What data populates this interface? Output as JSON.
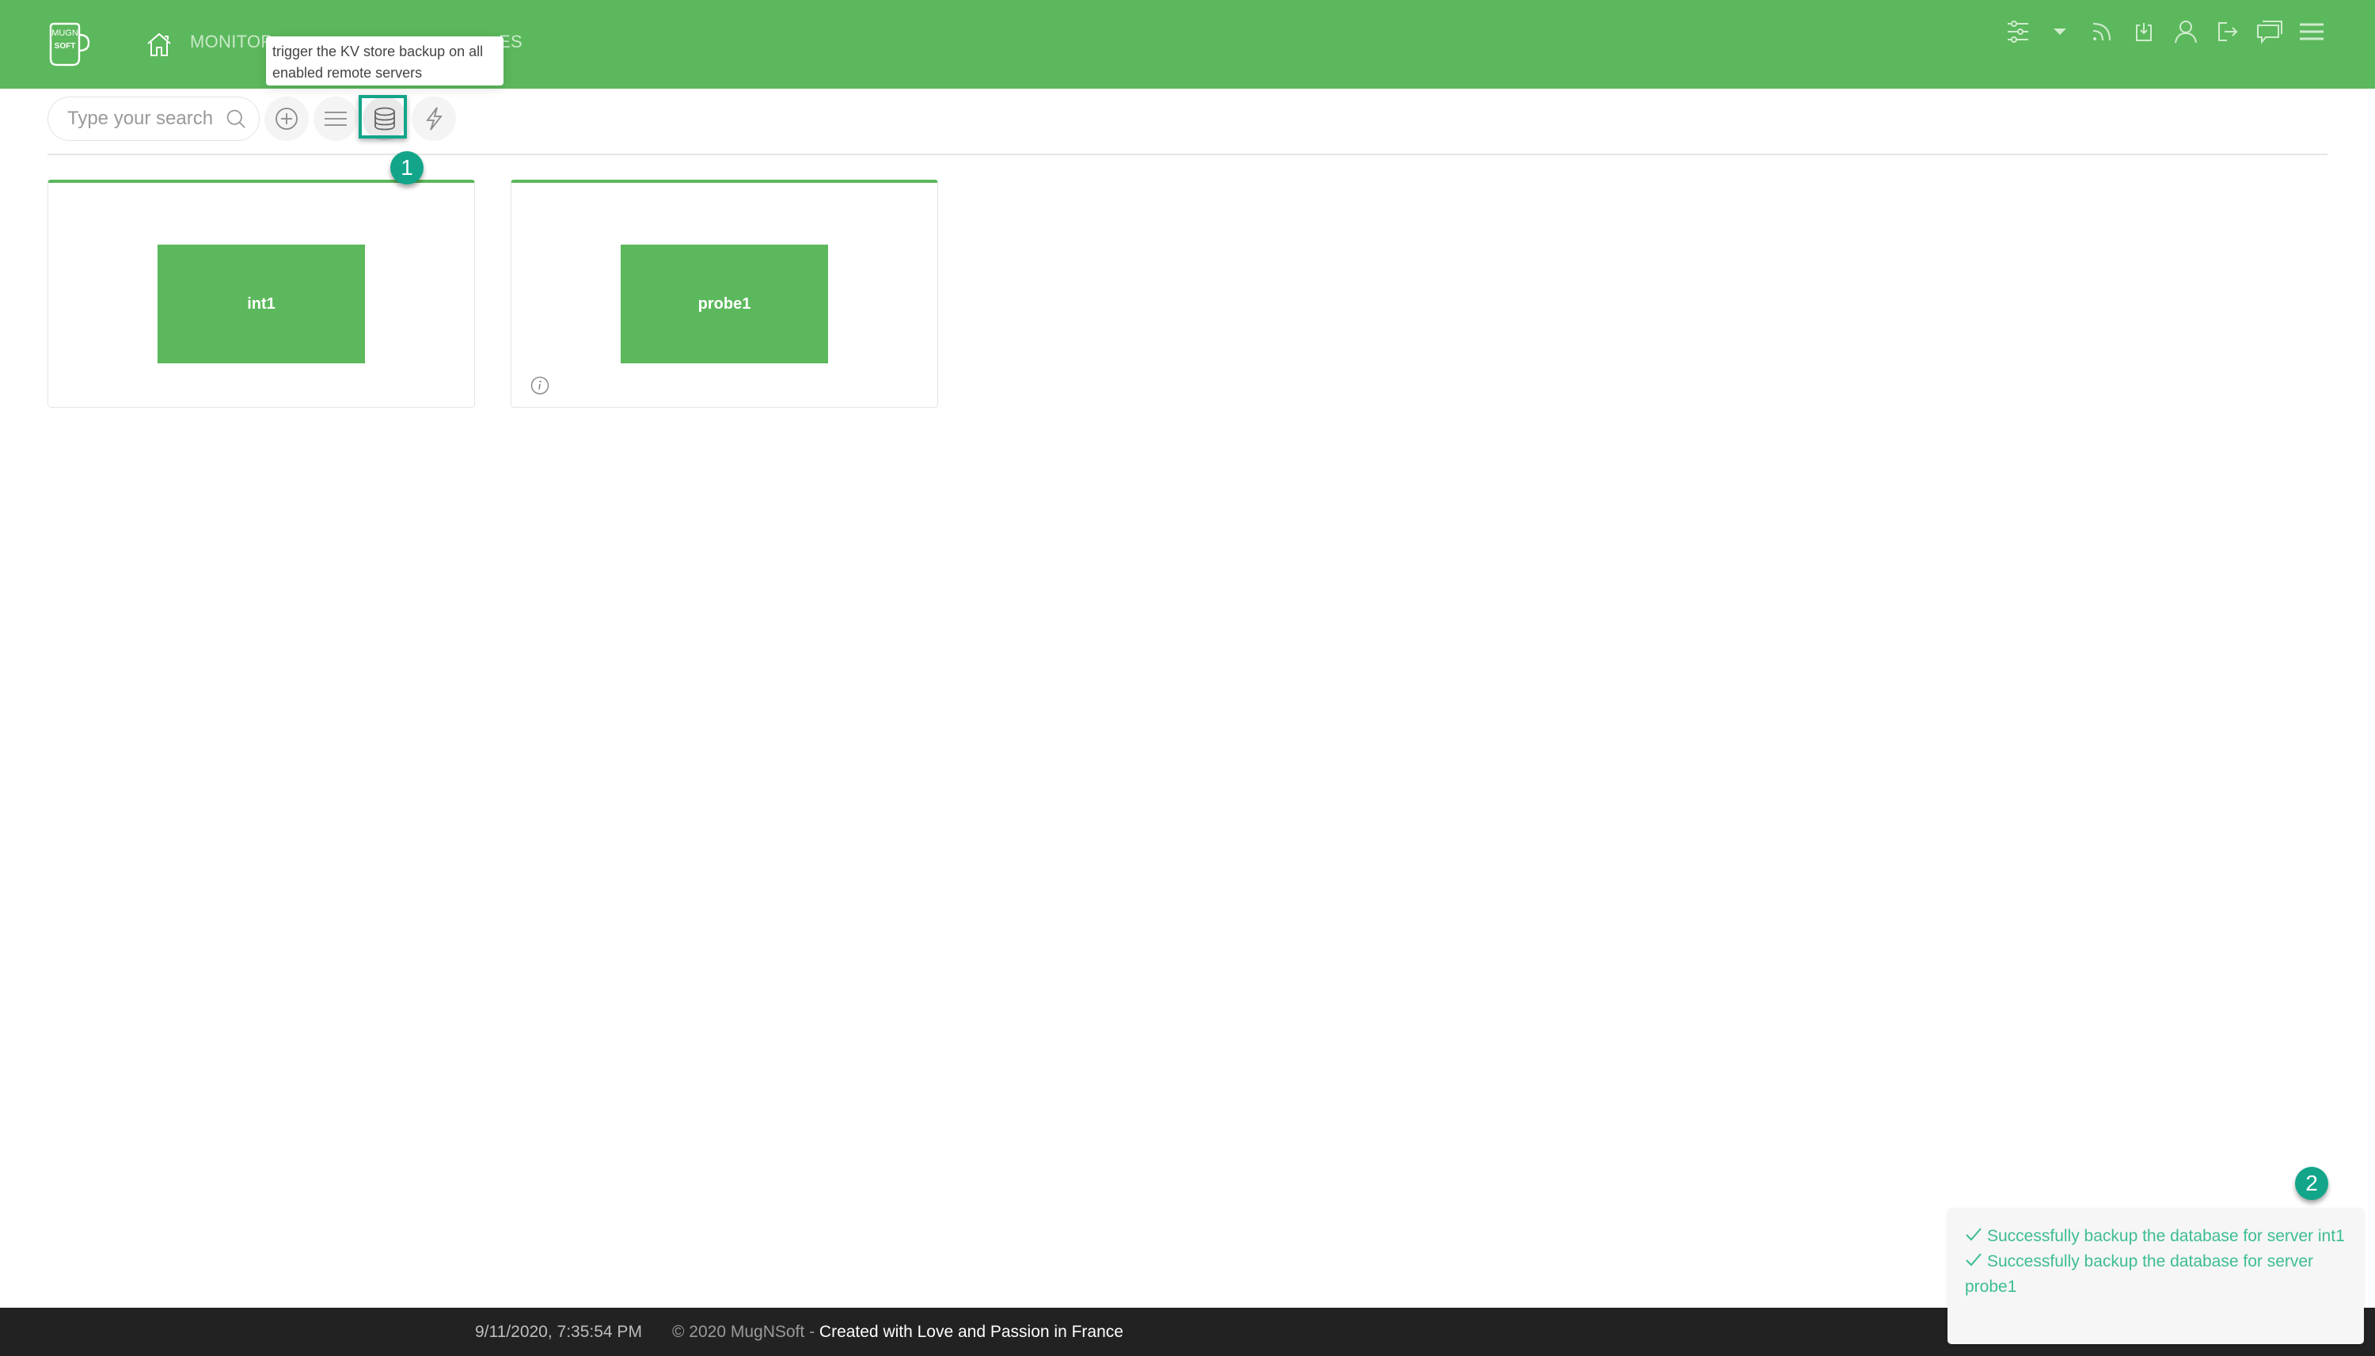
{
  "header": {
    "logo": {
      "top_text": "MUGN",
      "bottom_text": "SOFT",
      "icon": "mug-logo-icon"
    },
    "nav": [
      {
        "icon": "home-icon"
      },
      {
        "label": "MONITOR"
      },
      {
        "label": "ES"
      }
    ],
    "right_icons": [
      "sliders-icon",
      "caret-down-icon",
      "rss-icon",
      "download-icon",
      "user-icon",
      "logout-icon",
      "chat-icon",
      "hamburger-menu-icon"
    ],
    "background_color": "#5cb85c"
  },
  "tooltip": {
    "text": "trigger the KV store backup on all enabled remote servers"
  },
  "toolbar": {
    "search_placeholder": "Type your search",
    "buttons": [
      {
        "icon": "add-circle-icon",
        "name": "add"
      },
      {
        "icon": "list-icon",
        "name": "list"
      },
      {
        "icon": "database-icon",
        "name": "backup-kv-store",
        "active": true
      },
      {
        "icon": "lightning-icon",
        "name": "trigger"
      }
    ]
  },
  "annotations": {
    "badge_1": "1",
    "badge_2": "2",
    "color": "#13a58a"
  },
  "servers": [
    {
      "name": "int1",
      "has_info": false
    },
    {
      "name": "probe1",
      "has_info": true
    }
  ],
  "toast": {
    "messages": [
      "Successfully backup the database for server int1",
      "Successfully backup the database for server probe1"
    ],
    "color": "#3dbd8f"
  },
  "footer": {
    "datetime": "9/11/2020, 7:35:54 PM",
    "copyright": "© 2020 MugNSoft - ",
    "created": "Created with Love and Passion in France"
  }
}
